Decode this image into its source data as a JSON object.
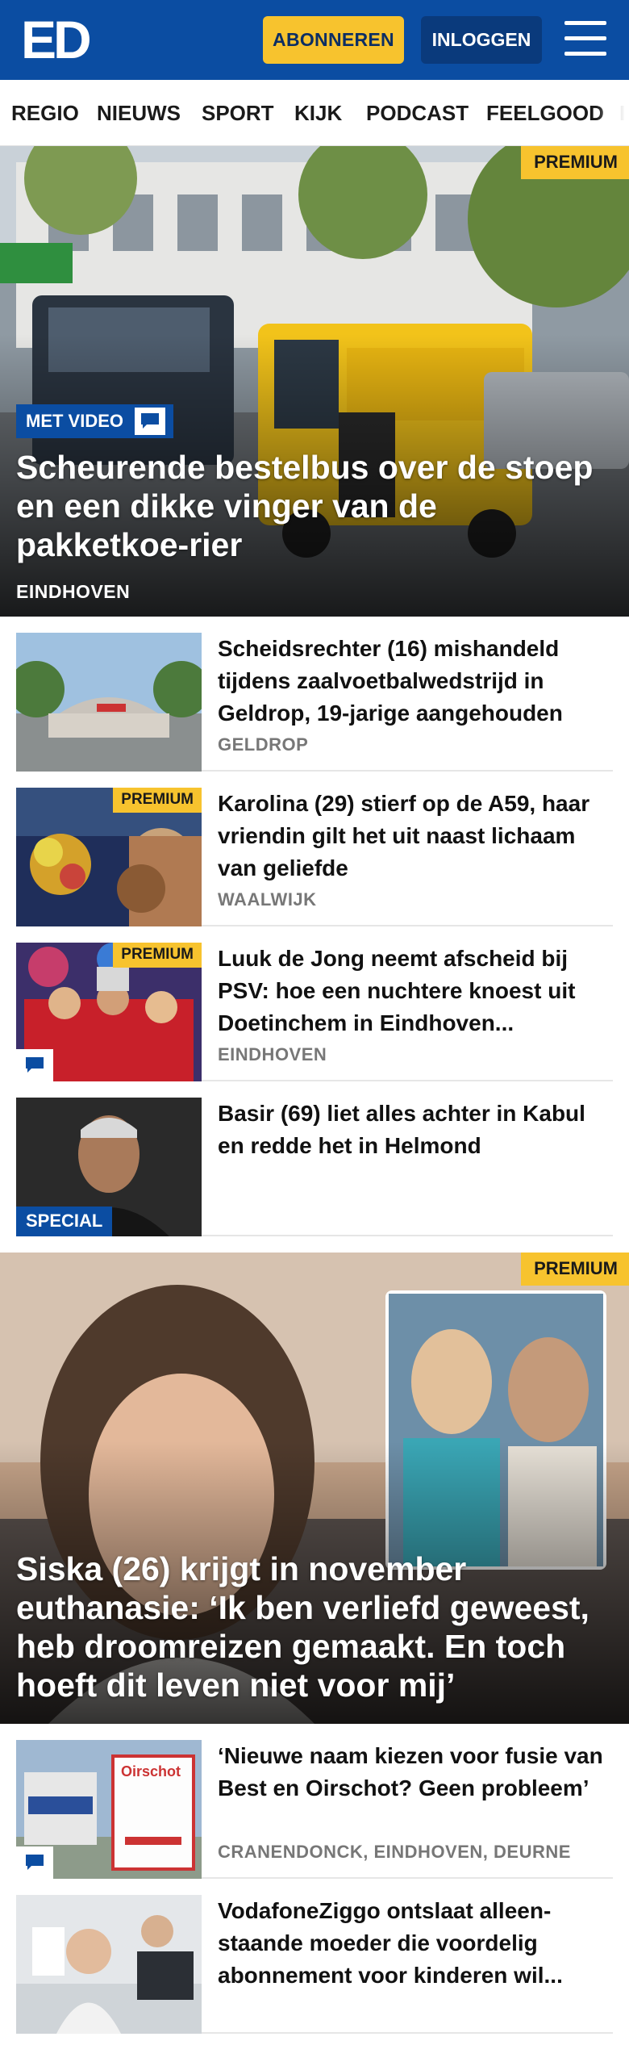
{
  "header": {
    "logo_text": "ED",
    "subscribe_label": "ABONNEREN",
    "login_label": "INLOGGEN",
    "menu_icon": "hamburger-menu-icon",
    "colors": {
      "brand_blue": "#0b4da2",
      "subscribe_yellow": "#f7c32e",
      "login_navy": "#0a3a7c"
    }
  },
  "nav": {
    "items": [
      "REGIO",
      "NIEUWS",
      "SPORT",
      "KIJK",
      "PODCAST",
      "FEELGOOD",
      "I"
    ]
  },
  "hero1": {
    "premium": "PREMIUM",
    "video_label": "MET VIDEO",
    "comment_icon": "comment-icon",
    "title": "Scheurende bestelbus over de stoep en een dikke vinger van de pakketkoe-rier",
    "location": "EINDHOVEN"
  },
  "articles": [
    {
      "title": "Scheidsrechter (16) mishandeld tijdens zaalvoetbalwedstrijd in Geldrop, 19-jarige aangehouden",
      "location": "GELDROP"
    },
    {
      "premium": "PREMIUM",
      "title": "Karolina (29) stierf op de A59, haar vriendin gilt het uit naast lichaam van geliefde",
      "location": "WAALWIJK"
    },
    {
      "premium": "PREMIUM",
      "title": "Luuk de Jong neemt afscheid bij PSV: hoe een nuchtere knoest uit Doetinchem in Eindhoven...",
      "location": "EINDHOVEN"
    },
    {
      "special": "SPECIAL",
      "title": "Basir (69) liet alles achter in Kabul en redde het in Helmond"
    }
  ],
  "hero2": {
    "premium": "PREMIUM",
    "title": "Siska (26) krijgt in november euthanasie: ‘Ik ben verliefd geweest, heb droomreizen gemaakt. En toch hoeft dit leven niet voor mij’"
  },
  "articles2": [
    {
      "title": "‘Nieuwe naam kiezen voor fusie van Best en Oirschot? Geen probleem’",
      "location": "CRANENDONCK, EINDHOVEN, DEURNE",
      "sign_text": "Oirschot"
    },
    {
      "title": "VodafoneZiggo ontslaat alleen-staande moeder die voordelig abonnement voor kinderen wil..."
    }
  ]
}
